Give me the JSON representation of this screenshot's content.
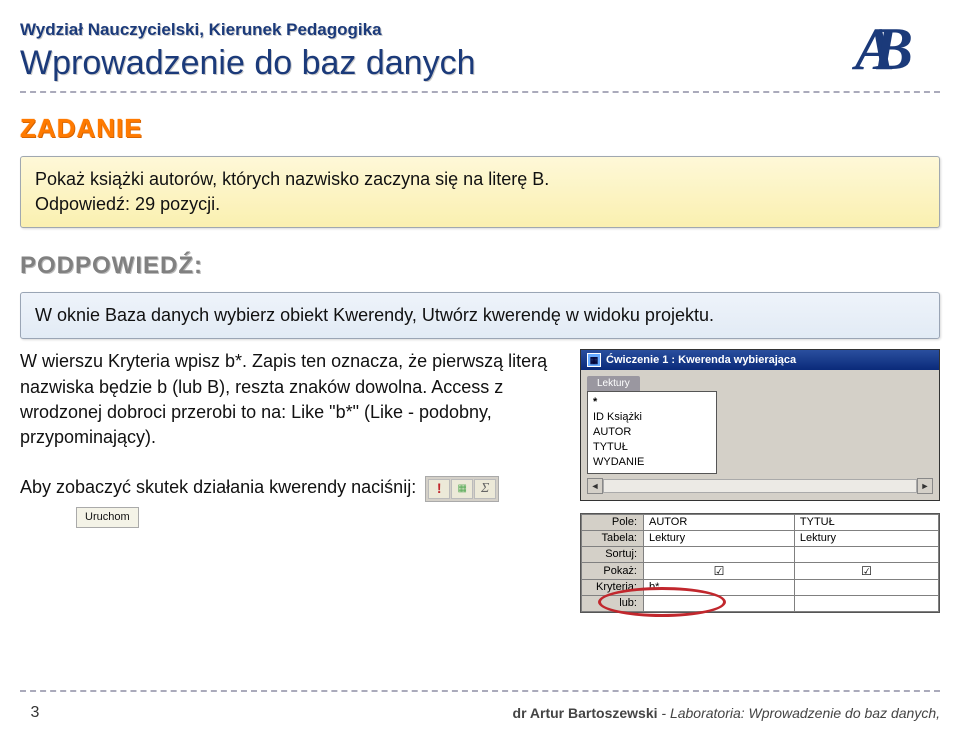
{
  "header": {
    "small": "Wydział Nauczycielski, Kierunek Pedagogika",
    "big": "Wprowadzenie do baz danych",
    "logo_chars": "AB"
  },
  "section_labels": {
    "zadanie": "ZADANIE",
    "podpowiedz": "PODPOWIEDŹ:"
  },
  "task": {
    "line1": "Pokaż książki autorów, których nazwisko zaczyna się na literę B.",
    "line2": "Odpowiedź: 29 pozycji."
  },
  "hint": "W oknie Baza danych wybierz obiekt Kwerendy, Utwórz kwerendę w widoku projektu.",
  "paragraph": {
    "p1": "W wierszu Kryteria wpisz b*. Zapis ten oznacza, że pierwszą literą nazwiska będzie b (lub B), reszta znaków dowolna. Access z wrodzonej dobroci przerobi to na: Like \"b*\" (Like - podobny, przypominający).",
    "p2": "Aby zobaczyć skutek działania kwerendy naciśnij:"
  },
  "toolbar": {
    "btn1": "!",
    "btn2": "▦",
    "btn3": "Σ",
    "label": "Uruchom"
  },
  "access": {
    "title": "Ćwiczenie 1 : Kwerenda wybierająca",
    "tab": "Lektury",
    "fields": [
      "*",
      "ID Książki",
      "AUTOR",
      "TYTUŁ",
      "WYDANIE"
    ],
    "rows": {
      "pole": "Pole:",
      "tabela": "Tabela:",
      "sortuj": "Sortuj:",
      "pokaz": "Pokaż:",
      "kryteria": "Kryteria:",
      "lub": "lub:"
    },
    "col1": {
      "pole": "AUTOR",
      "tabela": "Lektury",
      "kryt": "b*"
    },
    "col2": {
      "pole": "TYTUŁ",
      "tabela": "Lektury"
    },
    "check": "☑"
  },
  "footer": {
    "page": "3",
    "credit_author": "dr Artur Bartoszewski",
    "credit_rest": " - Laboratoria: Wprowadzenie do baz danych,"
  }
}
